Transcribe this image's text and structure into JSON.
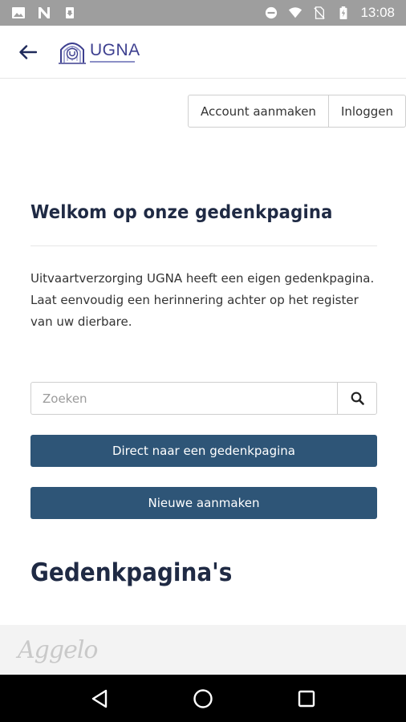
{
  "status_bar": {
    "time": "13:08"
  },
  "header": {
    "logo_text": "UGNA"
  },
  "account": {
    "create_label": "Account aanmaken",
    "login_label": "Inloggen"
  },
  "welcome": {
    "title": "Welkom op onze gedenkpagina",
    "intro": "Uitvaartverzorging UGNA heeft een eigen gedenkpagina. Laat eenvoudig een herinnering achter op het register van uw dierbare."
  },
  "search": {
    "placeholder": "Zoeken",
    "value": ""
  },
  "actions": {
    "direct_label": "Direct naar een gedenkpagina",
    "new_label": "Nieuwe aanmaken"
  },
  "pages_section": {
    "title": "Gedenkpagina's"
  },
  "footer": {
    "signature": "Aggelo"
  },
  "icons": {
    "back": "arrow-left-icon",
    "search": "magnifier-icon",
    "nav": [
      "back-triangle-icon",
      "home-circle-icon",
      "recents-square-icon"
    ]
  },
  "colors": {
    "primary": "#2e5577",
    "logo": "#3d3f8f",
    "status_bar": "#9e9e9e"
  }
}
